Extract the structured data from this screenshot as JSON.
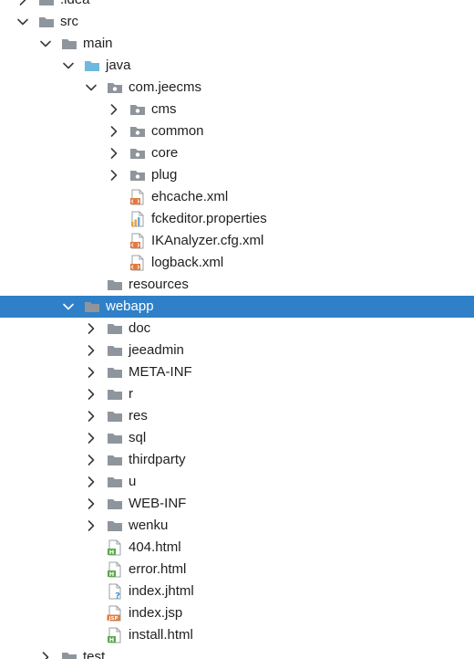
{
  "project_tree": {
    "colors": {
      "selection": "#2f80c8",
      "folder": "#8f959c",
      "source_folder": "#70b8e0",
      "xml_badge": "#e07a3f",
      "html_badge": "#5aa84a",
      "jsp_badge": "#e07a3f",
      "properties_bar": "#e8a23c",
      "unknown_badge": "#4a90d9"
    },
    "items": [
      {
        "label": ".idea",
        "depth": 0,
        "chevron": "right",
        "icon": "folder-icon"
      },
      {
        "label": "src",
        "depth": 0,
        "chevron": "down",
        "icon": "folder-icon"
      },
      {
        "label": "main",
        "depth": 1,
        "chevron": "down",
        "icon": "folder-icon"
      },
      {
        "label": "java",
        "depth": 2,
        "chevron": "down",
        "icon": "source-folder-icon"
      },
      {
        "label": "com.jeecms",
        "depth": 3,
        "chevron": "down",
        "icon": "package-icon"
      },
      {
        "label": "cms",
        "depth": 4,
        "chevron": "right",
        "icon": "package-icon"
      },
      {
        "label": "common",
        "depth": 4,
        "chevron": "right",
        "icon": "package-icon"
      },
      {
        "label": "core",
        "depth": 4,
        "chevron": "right",
        "icon": "package-icon"
      },
      {
        "label": "plug",
        "depth": 4,
        "chevron": "right",
        "icon": "package-icon"
      },
      {
        "label": "ehcache.xml",
        "depth": 4,
        "chevron": "none",
        "icon": "xml-file-icon"
      },
      {
        "label": "fckeditor.properties",
        "depth": 4,
        "chevron": "none",
        "icon": "properties-file-icon"
      },
      {
        "label": "IKAnalyzer.cfg.xml",
        "depth": 4,
        "chevron": "none",
        "icon": "xml-file-icon"
      },
      {
        "label": "logback.xml",
        "depth": 4,
        "chevron": "none",
        "icon": "xml-file-icon"
      },
      {
        "label": "resources",
        "depth": 3,
        "chevron": "none",
        "icon": "folder-icon"
      },
      {
        "label": "webapp",
        "depth": 2,
        "chevron": "down",
        "icon": "folder-icon",
        "selected": true
      },
      {
        "label": "doc",
        "depth": 3,
        "chevron": "right",
        "icon": "folder-icon"
      },
      {
        "label": "jeeadmin",
        "depth": 3,
        "chevron": "right",
        "icon": "folder-icon"
      },
      {
        "label": "META-INF",
        "depth": 3,
        "chevron": "right",
        "icon": "folder-icon"
      },
      {
        "label": "r",
        "depth": 3,
        "chevron": "right",
        "icon": "folder-icon"
      },
      {
        "label": "res",
        "depth": 3,
        "chevron": "right",
        "icon": "folder-icon"
      },
      {
        "label": "sql",
        "depth": 3,
        "chevron": "right",
        "icon": "folder-icon"
      },
      {
        "label": "thirdparty",
        "depth": 3,
        "chevron": "right",
        "icon": "folder-icon"
      },
      {
        "label": "u",
        "depth": 3,
        "chevron": "right",
        "icon": "folder-icon"
      },
      {
        "label": "WEB-INF",
        "depth": 3,
        "chevron": "right",
        "icon": "folder-icon"
      },
      {
        "label": "wenku",
        "depth": 3,
        "chevron": "right",
        "icon": "folder-icon"
      },
      {
        "label": "404.html",
        "depth": 3,
        "chevron": "none",
        "icon": "html-file-icon"
      },
      {
        "label": "error.html",
        "depth": 3,
        "chevron": "none",
        "icon": "html-file-icon"
      },
      {
        "label": "index.jhtml",
        "depth": 3,
        "chevron": "none",
        "icon": "unknown-file-icon"
      },
      {
        "label": "index.jsp",
        "depth": 3,
        "chevron": "none",
        "icon": "jsp-file-icon"
      },
      {
        "label": "install.html",
        "depth": 3,
        "chevron": "none",
        "icon": "html-file-icon"
      },
      {
        "label": "test",
        "depth": 1,
        "chevron": "right",
        "icon": "folder-icon"
      }
    ]
  }
}
